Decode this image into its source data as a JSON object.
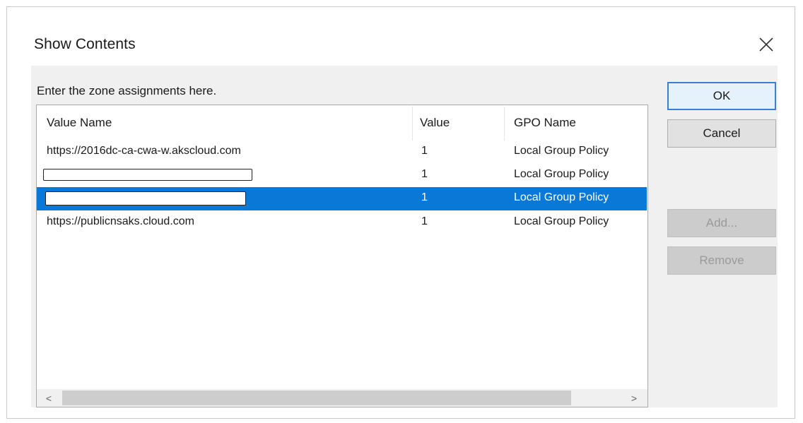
{
  "dialog": {
    "title": "Show Contents",
    "prompt": "Enter the zone assignments here."
  },
  "table": {
    "columns": [
      "Value Name",
      "Value",
      "GPO Name"
    ],
    "rows": [
      {
        "value_name": "https://2016dc-ca-cwa-w.akscloud.com",
        "value": "1",
        "gpo_name": "Local Group Policy",
        "redacted": false,
        "selected": false
      },
      {
        "value_name": "",
        "value": "1",
        "gpo_name": "Local Group Policy",
        "redacted": true,
        "selected": false
      },
      {
        "value_name": "",
        "value": "1",
        "gpo_name": "Local Group Policy",
        "redacted": true,
        "selected": true
      },
      {
        "value_name": "https://publicnsaks.cloud.com",
        "value": "1",
        "gpo_name": "Local Group Policy",
        "redacted": false,
        "selected": false
      }
    ]
  },
  "scrollbar": {
    "left_arrow": "<",
    "right_arrow": ">"
  },
  "buttons": {
    "ok": "OK",
    "cancel": "Cancel",
    "add": "Add...",
    "remove": "Remove"
  },
  "colors": {
    "selection": "#0a78d7",
    "client_background": "#f0f0f0",
    "default_button_border": "#3c7fd0"
  },
  "icons": {
    "close": "close-icon"
  }
}
